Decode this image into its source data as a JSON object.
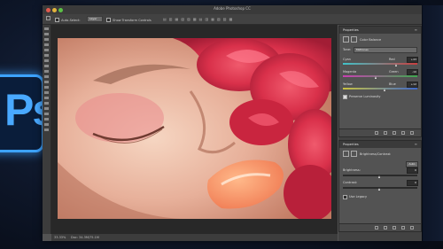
{
  "app": {
    "title": "Adobe Photoshop CC",
    "logo_text": "Ps"
  },
  "options_bar": {
    "auto_select_label": "Auto-Select:",
    "auto_select_value": "Layer",
    "transform_label": "Show Transform Controls"
  },
  "status_bar": {
    "zoom": "33.33%",
    "doc_info": "Doc: 34.3M/75.1M"
  },
  "properties_top": {
    "tab_label": "Properties",
    "adjustment_label": "Color Balance",
    "tone_label": "Tone:",
    "tone_value": "Midtones",
    "sliders": [
      {
        "left": "Cyan",
        "right": "Red",
        "value": "+43",
        "position": 0.72,
        "color": "#c93f3f"
      },
      {
        "left": "Magenta",
        "right": "Green",
        "value": "-10",
        "position": 0.45,
        "color": "#3fa84f"
      },
      {
        "left": "Yellow",
        "right": "Blue",
        "value": "+12",
        "position": 0.56,
        "color": "#3f68c9"
      }
    ],
    "preserve_label": "Preserve Luminosity",
    "preserve_checked": true
  },
  "properties_bottom": {
    "tab_label": "Properties",
    "adjustment_label": "Brightness/Contrast",
    "auto_label": "Auto",
    "brightness_label": "Brightness:",
    "brightness_value": "0",
    "contrast_label": "Contrast:",
    "contrast_value": "0",
    "legacy_label": "Use Legacy"
  },
  "colors": {
    "panel_bg": "#535353",
    "canvas_bg": "#282828",
    "accent_blue": "#3da3ff"
  }
}
